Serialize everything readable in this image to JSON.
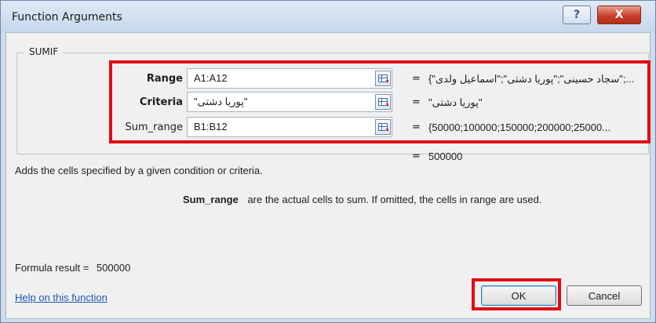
{
  "window": {
    "title": "Function Arguments",
    "help_glyph": "?",
    "close_glyph": "X"
  },
  "function_name": "SUMIF",
  "arguments": [
    {
      "label": "Range",
      "value": "A1:A12",
      "result": "{\"سجاد حسینی\";\"پوریا دشتی\";\"اسماعیل ولدی\";..."
    },
    {
      "label": "Criteria",
      "value": "\"پوریا دشتی\"",
      "result": "\"پوریا دشتی\""
    },
    {
      "label": "Sum_range",
      "value": "B1:B12",
      "result": "{50000;100000;150000;200000;25000..."
    }
  ],
  "equals_sign": "=",
  "function_result": "500000",
  "description": "Adds the cells specified by a given condition or criteria.",
  "argument_help": {
    "name": "Sum_range",
    "text": "are the actual cells to sum. If omitted, the cells in range are used."
  },
  "formula_result": {
    "label": "Formula result =",
    "value": "500000"
  },
  "help_link": "Help on this function",
  "buttons": {
    "ok": "OK",
    "cancel": "Cancel"
  },
  "colors": {
    "highlight": "#e30a12",
    "link": "#1e56b5"
  }
}
